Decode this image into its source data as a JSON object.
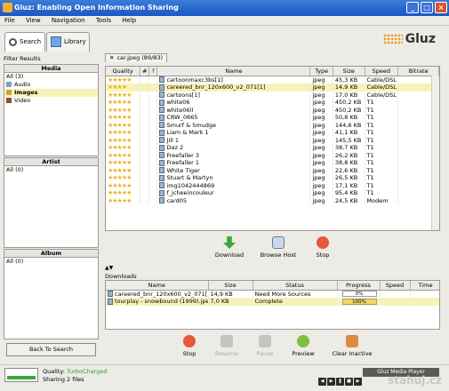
{
  "window": {
    "title": "Gluz: Enabling Open Information Sharing"
  },
  "menu": [
    "File",
    "View",
    "Navigation",
    "Tools",
    "Help"
  ],
  "nav": {
    "search": "Search",
    "library": "Library",
    "logo": "Gluz"
  },
  "left": {
    "filter_label": "Filter Results",
    "media": {
      "header": "Media",
      "items": [
        {
          "label": "All (3)"
        },
        {
          "label": "Audio"
        },
        {
          "label": "Images"
        },
        {
          "label": "Video"
        }
      ]
    },
    "artist": {
      "header": "Artist",
      "items": [
        {
          "label": "All (0)"
        }
      ]
    },
    "album": {
      "header": "Album",
      "items": [
        {
          "label": "All (0)"
        }
      ]
    },
    "back_button": "Back To Search"
  },
  "search_tab": "car.jpeg (89/83)",
  "results": {
    "columns": [
      "Quality",
      "#",
      "",
      "Name",
      "Type",
      "Size",
      "Speed",
      "Bitrate"
    ],
    "rows": [
      {
        "stars": "★★★★★",
        "name": "cartoonmaxc3bs[1]",
        "type": "jpeg",
        "size": "45,3 KB",
        "speed": "Cable/DSL"
      },
      {
        "stars": "★★★★",
        "name": "careered_bnr_120x600_v2_071[1]",
        "type": "jpeg",
        "size": "14,9 KB",
        "speed": "Cable/DSL"
      },
      {
        "stars": "★★★★★",
        "name": "cartoons[1]",
        "type": "jpeg",
        "size": "17,0 KB",
        "speed": "Cable/DSL"
      },
      {
        "stars": "★★★★★",
        "name": "white06",
        "type": "jpeg",
        "size": "450,2 KB",
        "speed": "T1"
      },
      {
        "stars": "★★★★★",
        "name": "white06ll",
        "type": "jpeg",
        "size": "450,2 KB",
        "speed": "T1"
      },
      {
        "stars": "★★★★★",
        "name": "CRW_0665",
        "type": "jpeg",
        "size": "50,8 KB",
        "speed": "T1"
      },
      {
        "stars": "★★★★★",
        "name": "Smurf & Smudge",
        "type": "jpeg",
        "size": "144,6 KB",
        "speed": "T1"
      },
      {
        "stars": "★★★★★",
        "name": "Liam & Mark 1",
        "type": "jpeg",
        "size": "41,1 KB",
        "speed": "T1"
      },
      {
        "stars": "★★★★★",
        "name": "Jill 1",
        "type": "jpeg",
        "size": "145,5 KB",
        "speed": "T1"
      },
      {
        "stars": "★★★★★",
        "name": "Daz 2",
        "type": "jpeg",
        "size": "38,7 KB",
        "speed": "T1"
      },
      {
        "stars": "★★★★★",
        "name": "Freefaller 3",
        "type": "jpeg",
        "size": "26,2 KB",
        "speed": "T1"
      },
      {
        "stars": "★★★★★",
        "name": "Freefaller 1",
        "type": "jpeg",
        "size": "38,8 KB",
        "speed": "T1"
      },
      {
        "stars": "★★★★★",
        "name": "White Tiger",
        "type": "jpeg",
        "size": "22,6 KB",
        "speed": "T1"
      },
      {
        "stars": "★★★★★",
        "name": "Stuart & Martyn",
        "type": "jpeg",
        "size": "26,5 KB",
        "speed": "T1"
      },
      {
        "stars": "★★★★★",
        "name": "img1042444869",
        "type": "jpeg",
        "size": "17,1 KB",
        "speed": "T1"
      },
      {
        "stars": "★★★★★",
        "name": "f_jcheeincouleur",
        "type": "jpeg",
        "size": "95,4 KB",
        "speed": "T1"
      },
      {
        "stars": "★★★★★",
        "name": "card05",
        "type": "jpeg",
        "size": "24,5 KB",
        "speed": "Modem"
      }
    ]
  },
  "actions": {
    "download": "Download",
    "browse_host": "Browse Host",
    "stop": "Stop"
  },
  "downloads": {
    "label": "Downloads",
    "columns": [
      "Name",
      "Size",
      "Status",
      "Progress",
      "Speed",
      "Time"
    ],
    "rows": [
      {
        "name": "careered_bnr_120x600_v2_071[1].j...",
        "size": "14,9 KB",
        "status": "Need More Sources",
        "progress_text": "0%",
        "progress": 0
      },
      {
        "name": "tourplay - snowbound (1999).jpeg",
        "size": "7,0 KB",
        "status": "Complete",
        "progress_text": "100%",
        "progress": 1
      }
    ]
  },
  "dl_actions": {
    "stop": "Stop",
    "resume": "Resume",
    "pause": "Pause",
    "preview": "Preview",
    "clear": "Clear Inactive"
  },
  "status": {
    "quality_label": "Quality:",
    "quality_value": "TurboCharged",
    "sharing": "Sharing 2 files",
    "player": "Gluz Media Player",
    "watermark": "stahuj.cz"
  },
  "colors": {
    "accent": "#3a7ed8",
    "highlight": "#f7f3b8",
    "star": "#e6b51f",
    "turbo": "#2fa02f"
  }
}
